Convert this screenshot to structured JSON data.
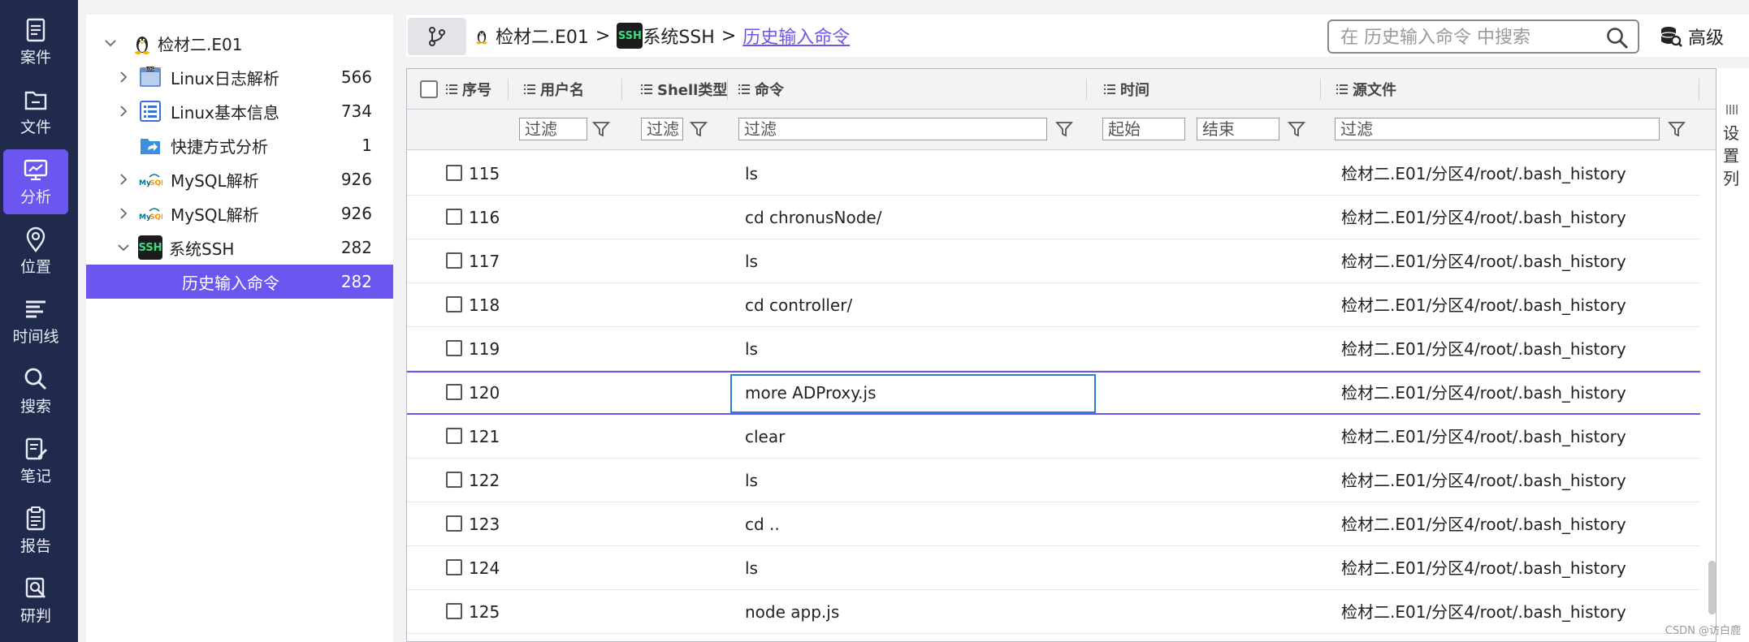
{
  "nav": {
    "items": [
      {
        "label": "案件",
        "icon": "case-icon"
      },
      {
        "label": "文件",
        "icon": "file-icon"
      },
      {
        "label": "分析",
        "icon": "analysis-icon"
      },
      {
        "label": "位置",
        "icon": "location-icon"
      },
      {
        "label": "时间线",
        "icon": "timeline-icon"
      },
      {
        "label": "搜索",
        "icon": "search-icon"
      },
      {
        "label": "笔记",
        "icon": "note-icon"
      },
      {
        "label": "报告",
        "icon": "report-icon"
      },
      {
        "label": "研判",
        "icon": "judge-icon"
      }
    ],
    "active": "分析"
  },
  "tree": {
    "root": {
      "label": "检材二.E01",
      "icon": "linux-penguin-icon"
    },
    "items": [
      {
        "label": "Linux日志解析",
        "count": "566",
        "icon": "log-icon"
      },
      {
        "label": "Linux基本信息",
        "count": "734",
        "icon": "list-icon"
      },
      {
        "label": "快捷方式分析",
        "count": "1",
        "icon": "shortcut-folder-icon"
      },
      {
        "label": "MySQL解析",
        "count": "926",
        "icon": "mysql-icon"
      },
      {
        "label": "MySQL解析",
        "count": "926",
        "icon": "mysql-icon"
      },
      {
        "label": "系统SSH",
        "count": "282",
        "icon": "ssh-icon",
        "badge": "SSH"
      },
      {
        "label": "历史输入命令",
        "count": "282",
        "selected": true
      }
    ]
  },
  "breadcrumb": {
    "root": "检材二.E01",
    "ssh_badge": "SSH",
    "middle": "系统SSH",
    "current": "历史输入命令",
    "sep": ">"
  },
  "search": {
    "placeholder": "在 历史输入命令 中搜索"
  },
  "advanced": {
    "label": "高级"
  },
  "table": {
    "columns": [
      "序号",
      "用户名",
      "Shell类型",
      "命令",
      "时间",
      "源文件"
    ],
    "filters": {
      "placeholder": "过滤",
      "start": "起始",
      "end": "结束"
    },
    "rows": [
      {
        "seq": "115",
        "command": "ls",
        "source": "检材二.E01/分区4/root/.bash_history"
      },
      {
        "seq": "116",
        "command": "cd chronusNode/",
        "source": "检材二.E01/分区4/root/.bash_history"
      },
      {
        "seq": "117",
        "command": "ls",
        "source": "检材二.E01/分区4/root/.bash_history"
      },
      {
        "seq": "118",
        "command": "cd controller/",
        "source": "检材二.E01/分区4/root/.bash_history"
      },
      {
        "seq": "119",
        "command": "ls",
        "source": "检材二.E01/分区4/root/.bash_history"
      },
      {
        "seq": "120",
        "command": "more ADProxy.js",
        "source": "检材二.E01/分区4/root/.bash_history",
        "focused": true
      },
      {
        "seq": "121",
        "command": "clear",
        "source": "检材二.E01/分区4/root/.bash_history"
      },
      {
        "seq": "122",
        "command": "ls",
        "source": "检材二.E01/分区4/root/.bash_history"
      },
      {
        "seq": "123",
        "command": "cd ..",
        "source": "检材二.E01/分区4/root/.bash_history"
      },
      {
        "seq": "124",
        "command": "ls",
        "source": "检材二.E01/分区4/root/.bash_history"
      },
      {
        "seq": "125",
        "command": "node app.js",
        "source": "检材二.E01/分区4/root/.bash_history"
      }
    ]
  },
  "column_settings": {
    "label": "设置列"
  },
  "watermark": "CSDN @访白鹿",
  "colors": {
    "nav_bg": "#1f2a4d",
    "accent": "#6c56f0",
    "focus_border": "#2b7fd9"
  }
}
